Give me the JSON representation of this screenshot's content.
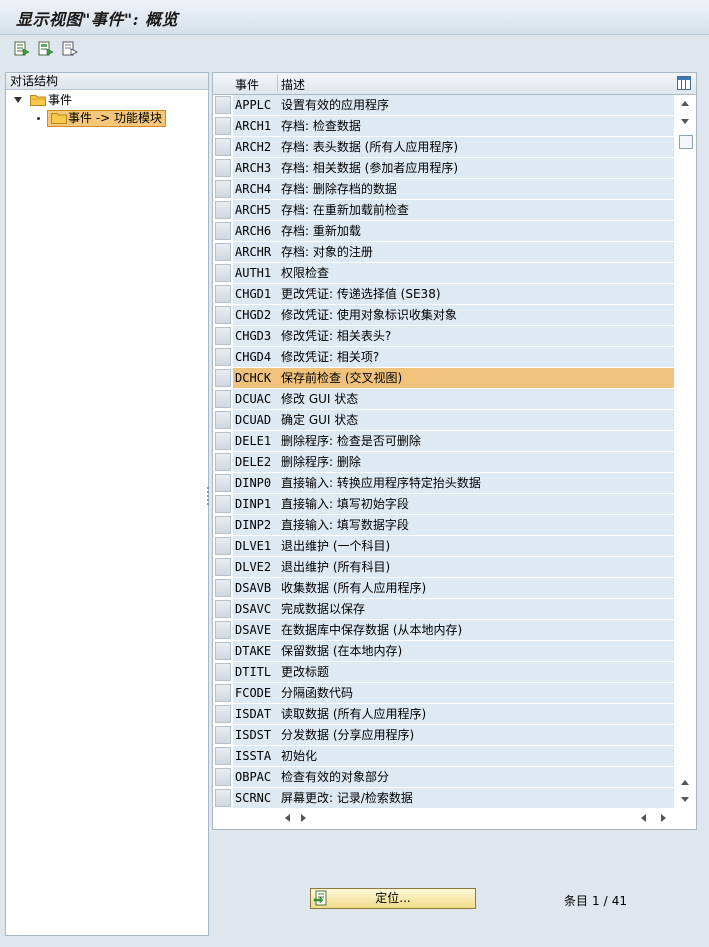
{
  "window": {
    "title": "显示视图\"事件\": 概览"
  },
  "toolbar": {
    "icons": [
      "export-icon",
      "export-highlight-icon",
      "export-doc-icon"
    ]
  },
  "tree": {
    "header": "对话结构",
    "root_label": "事件",
    "child_label": "事件 -> 功能模块"
  },
  "table": {
    "col_event": "事件",
    "col_desc": "描述",
    "selected_code": "DCHCK",
    "rows": [
      {
        "code": "APPLC",
        "desc": "设置有效的应用程序"
      },
      {
        "code": "ARCH1",
        "desc": "存档: 检查数据"
      },
      {
        "code": "ARCH2",
        "desc": "存档: 表头数据 (所有人应用程序)"
      },
      {
        "code": "ARCH3",
        "desc": "存档: 相关数据 (参加者应用程序)"
      },
      {
        "code": "ARCH4",
        "desc": "存档: 删除存档的数据"
      },
      {
        "code": "ARCH5",
        "desc": "存档: 在重新加载前检查"
      },
      {
        "code": "ARCH6",
        "desc": "存档: 重新加载"
      },
      {
        "code": "ARCHR",
        "desc": "存档: 对象的注册"
      },
      {
        "code": "AUTH1",
        "desc": "权限检查"
      },
      {
        "code": "CHGD1",
        "desc": "更改凭证: 传递选择值 (SE38)"
      },
      {
        "code": "CHGD2",
        "desc": "修改凭证: 使用对象标识收集对象"
      },
      {
        "code": "CHGD3",
        "desc": "修改凭证: 相关表头?"
      },
      {
        "code": "CHGD4",
        "desc": "修改凭证: 相关项?"
      },
      {
        "code": "DCHCK",
        "desc": "保存前检查 (交叉视图)"
      },
      {
        "code": "DCUAC",
        "desc": "修改 GUI 状态"
      },
      {
        "code": "DCUAD",
        "desc": "确定 GUI 状态"
      },
      {
        "code": "DELE1",
        "desc": "删除程序: 检查是否可删除"
      },
      {
        "code": "DELE2",
        "desc": "删除程序: 删除"
      },
      {
        "code": "DINP0",
        "desc": "直接输入: 转换应用程序特定抬头数据"
      },
      {
        "code": "DINP1",
        "desc": "直接输入: 填写初始字段"
      },
      {
        "code": "DINP2",
        "desc": "直接输入: 填写数据字段"
      },
      {
        "code": "DLVE1",
        "desc": "退出维护 (一个科目)"
      },
      {
        "code": "DLVE2",
        "desc": "退出维护 (所有科目)"
      },
      {
        "code": "DSAVB",
        "desc": "收集数据 (所有人应用程序)"
      },
      {
        "code": "DSAVC",
        "desc": "完成数据以保存"
      },
      {
        "code": "DSAVE",
        "desc": "在数据库中保存数据 (从本地内存)"
      },
      {
        "code": "DTAKE",
        "desc": "保留数据 (在本地内存)"
      },
      {
        "code": "DTITL",
        "desc": "更改标题"
      },
      {
        "code": "FCODE",
        "desc": "分隔函数代码"
      },
      {
        "code": "ISDAT",
        "desc": "读取数据 (所有人应用程序)"
      },
      {
        "code": "ISDST",
        "desc": "分发数据 (分享应用程序)"
      },
      {
        "code": "ISSTA",
        "desc": "初始化"
      },
      {
        "code": "OBPAC",
        "desc": "检查有效的对象部分"
      },
      {
        "code": "SCRNC",
        "desc": "屏幕更改: 记录/检索数据"
      }
    ]
  },
  "footer": {
    "locate_label": "定位...",
    "entry_word": "条目",
    "entry_current": "1",
    "entry_sep": "/",
    "entry_total": "41"
  },
  "colors": {
    "row_bg": "#dfe9f4",
    "row_selected": "#f0c27c",
    "window_bg": "#dfe6ee"
  }
}
